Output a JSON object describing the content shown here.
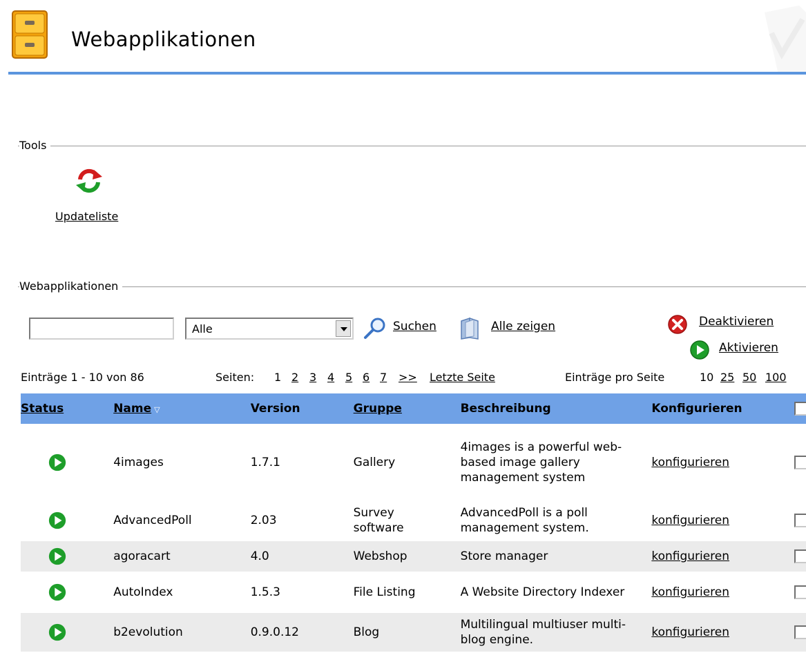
{
  "header": {
    "title": "Webapplikationen"
  },
  "tools": {
    "legend": "Tools",
    "update_label": "Updateliste"
  },
  "apps_section": {
    "legend": "Webapplikationen"
  },
  "search": {
    "input_value": "",
    "filter_selected": "Alle",
    "search_label": "Suchen",
    "show_all_label": "Alle zeigen",
    "deactivate_label": "Deaktivieren",
    "activate_label": "Aktivieren"
  },
  "pager": {
    "range_text": "Einträge 1 - 10 von 86",
    "pages_label": "Seiten:",
    "current_page": "1",
    "pages": [
      "2",
      "3",
      "4",
      "5",
      "6",
      "7",
      ">>"
    ],
    "last_page_label": "Letzte Seite",
    "per_page_label": "Einträge pro Seite",
    "per_page_current": "10",
    "per_page_options": [
      "25",
      "50",
      "100"
    ]
  },
  "table": {
    "columns": {
      "status": "Status",
      "name": "Name",
      "version": "Version",
      "gruppe": "Gruppe",
      "beschreibung": "Beschreibung",
      "konfigurieren": "Konfigurieren"
    },
    "rows": [
      {
        "name": "4images",
        "version": "1.7.1",
        "gruppe": "Gallery",
        "beschreibung": "4images is a powerful web-based image gallery management system",
        "konfigurieren": "konfigurieren"
      },
      {
        "name": "AdvancedPoll",
        "version": "2.03",
        "gruppe": "Survey software",
        "beschreibung": "AdvancedPoll is a poll management system.",
        "konfigurieren": "konfigurieren"
      },
      {
        "name": "agoracart",
        "version": "4.0",
        "gruppe": "Webshop",
        "beschreibung": "Store manager",
        "konfigurieren": "konfigurieren"
      },
      {
        "name": "AutoIndex",
        "version": "1.5.3",
        "gruppe": "File Listing",
        "beschreibung": "A Website Directory Indexer",
        "konfigurieren": "konfigurieren"
      },
      {
        "name": "b2evolution",
        "version": "0.9.0.12",
        "gruppe": "Blog",
        "beschreibung": "Multilingual multiuser multi-blog engine.",
        "konfigurieren": "konfigurieren"
      }
    ]
  },
  "colors": {
    "header_line": "#5b95de",
    "table_header": "#6fa1e6",
    "row_alt": "#ebebeb",
    "status_active": "#1e9e2a"
  }
}
